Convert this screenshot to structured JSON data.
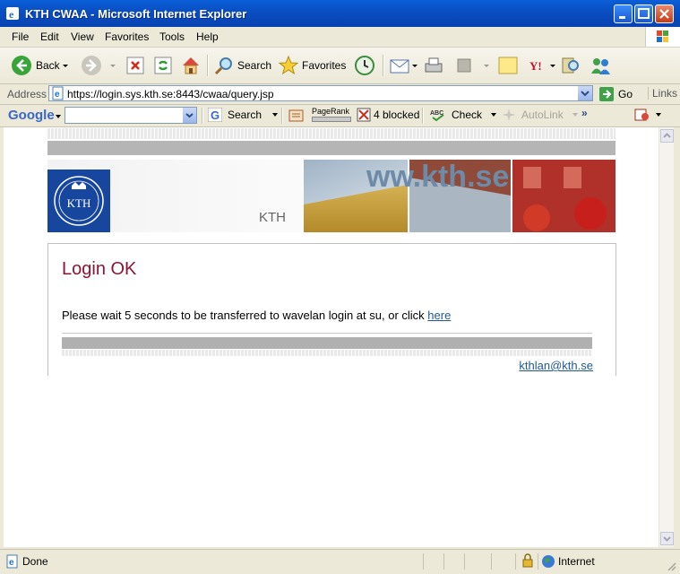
{
  "window": {
    "title": "KTH CWAA - Microsoft Internet Explorer"
  },
  "menu": {
    "items": [
      "File",
      "Edit",
      "View",
      "Favorites",
      "Tools",
      "Help"
    ]
  },
  "toolbar": {
    "back": "Back",
    "search": "Search",
    "favorites": "Favorites"
  },
  "address": {
    "label": "Address",
    "url": "https://login.sys.kth.se:8443/cwaa/query.jsp",
    "go": "Go",
    "links": "Links"
  },
  "googlebar": {
    "brand": "Google",
    "search": "Search",
    "pagerank": "PageRank",
    "blocked": "4 blocked",
    "check": "Check",
    "autolink": "AutoLink",
    "more": "»"
  },
  "page": {
    "banner_text": "KTH",
    "logo_text": "KTH",
    "heading": "Login OK",
    "message": "Please wait 5 seconds to be transferred to wavelan login at su, or click",
    "link": "here",
    "email": "kthlan@kth.se"
  },
  "status": {
    "left": "Done",
    "zone": "Internet"
  },
  "colors": {
    "titlebar": "#0a4fc4",
    "heading": "#8b1533",
    "link": "#1f5a94",
    "kth_blue": "#17469e"
  }
}
